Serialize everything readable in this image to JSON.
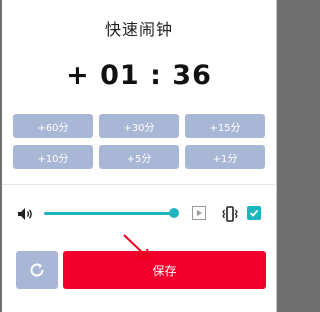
{
  "dialog": {
    "title": "快速闹钟",
    "timer": "+ 01 : 36"
  },
  "quick_add": {
    "buttons": [
      "+60分",
      "+30分",
      "+15分",
      "+10分",
      "+5分",
      "+1分"
    ]
  },
  "audio": {
    "volume_level": 1.0,
    "vibrate_checked": true
  },
  "actions": {
    "save_label": "保存"
  },
  "colors": {
    "accent": "#1fb5bd",
    "button_blue": "#a9b7d6",
    "save_red": "#f2002b",
    "annotation_arrow": "#e8001c"
  },
  "icons": [
    "volume-icon",
    "play-icon",
    "vibrate-icon",
    "check-icon",
    "refresh-icon",
    "arrow-annotation-icon"
  ]
}
